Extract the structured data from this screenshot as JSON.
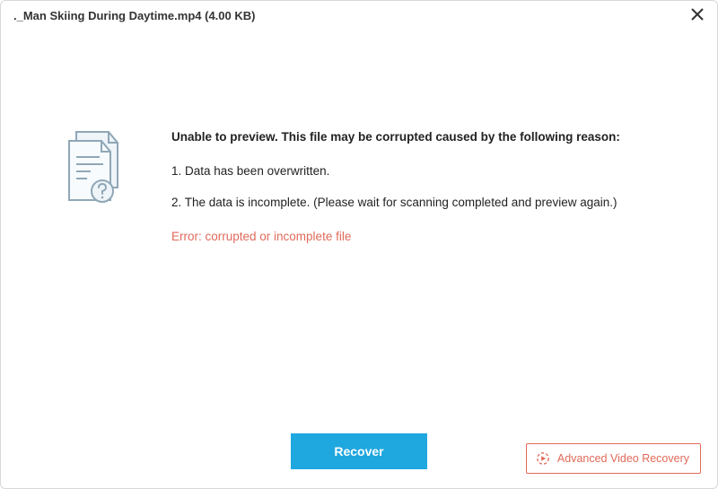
{
  "titlebar": {
    "filename": "._Man Skiing During Daytime.mp4",
    "filesize": "(4.00  KB)"
  },
  "message": {
    "heading": "Unable to preview. This file may be corrupted caused by the following reason:",
    "reason1": "1. Data has been overwritten.",
    "reason2": "2. The data is incomplete. (Please wait for scanning completed and preview again.)",
    "error": "Error: corrupted or incomplete file"
  },
  "buttons": {
    "recover": "Recover",
    "advanced": "Advanced Video Recovery"
  }
}
